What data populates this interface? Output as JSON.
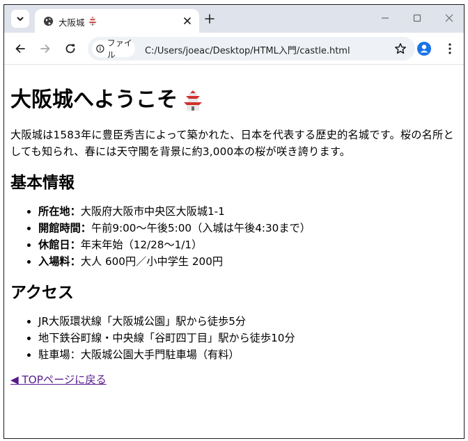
{
  "browser": {
    "tab_title": "大阪城",
    "site_chip_label": "ファイル",
    "url": "C:/Users/joeac/Desktop/HTML入門/castle.html"
  },
  "page": {
    "heading": "大阪城へようこそ",
    "heading_emoji": "castle",
    "intro": "大阪城は1583年に豊臣秀吉によって築かれた、日本を代表する歴史的名城です。桜の名所としても知られ、春には天守閣を背景に約3,000本の桜が咲き誇ります。",
    "basic_info": {
      "heading": "基本情報",
      "items": [
        {
          "label": "所在地：",
          "value": "大阪府大阪市中央区大阪城1-1"
        },
        {
          "label": "開館時間：",
          "value": "午前9:00～午後5:00（入城は午後4:30まで）"
        },
        {
          "label": "休館日：",
          "value": "年末年始（12/28～1/1）"
        },
        {
          "label": "入場料：",
          "value": "大人 600円／小中学生 200円"
        }
      ]
    },
    "access": {
      "heading": "アクセス",
      "items": [
        "JR大阪環状線「大阪城公園」駅から徒歩5分",
        "地下鉄谷町線・中央線「谷町四丁目」駅から徒歩10分",
        "駐車場：大阪城公園大手門駐車場（有料）"
      ]
    },
    "back_link": "◀ TOPページに戻る"
  },
  "colors": {
    "tabstrip_bg": "#dfe3eb",
    "omnibox_bg": "#eef1f5",
    "link_visited": "#551a8b",
    "profile_blue": "#1a73e8",
    "castle_red": "#d0312d"
  }
}
